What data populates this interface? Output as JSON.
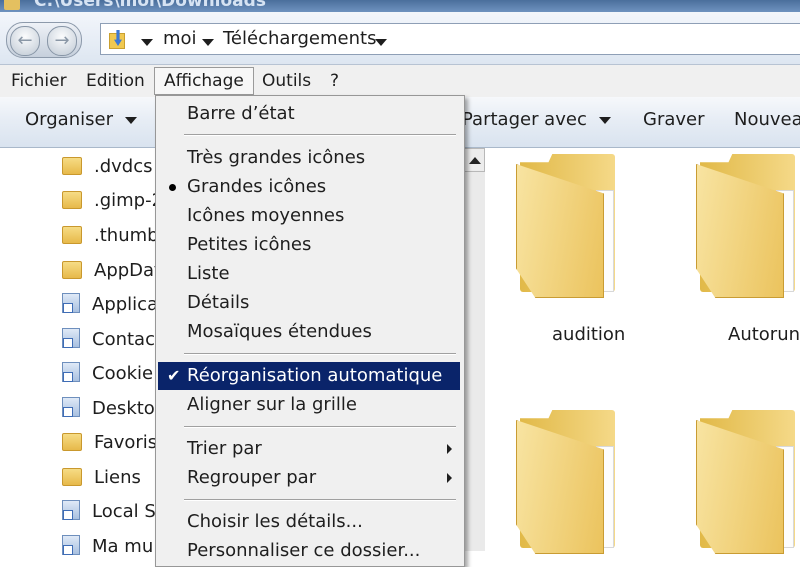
{
  "window": {
    "title": "C:\\Users\\moi\\Downloads"
  },
  "address_bar": {
    "crumbs": [
      "moi",
      "Téléchargements"
    ]
  },
  "menu_bar": {
    "items": [
      "Fichier",
      "Edition",
      "Affichage",
      "Outils",
      "?"
    ],
    "active": "Affichage"
  },
  "toolbar": {
    "organize": "Organiser",
    "share_with": "Partager avec",
    "burn": "Graver",
    "new_folder": "Nouvea"
  },
  "nav_pane": {
    "items": [
      {
        "label": ".dvdcs",
        "icon": "folder-icon"
      },
      {
        "label": ".gimp-2",
        "icon": "folder-icon"
      },
      {
        "label": ".thumb",
        "icon": "folder-icon"
      },
      {
        "label": "AppDat",
        "icon": "folder-icon"
      },
      {
        "label": "Applica",
        "icon": "shortcut-icon"
      },
      {
        "label": "Contac",
        "icon": "contacts-icon"
      },
      {
        "label": "Cookie",
        "icon": "shortcut-icon"
      },
      {
        "label": "Deskto",
        "icon": "desktop-icon"
      },
      {
        "label": "Favoris",
        "icon": "favorites-icon"
      },
      {
        "label": "Liens",
        "icon": "links-icon"
      },
      {
        "label": "Local S",
        "icon": "shortcut-icon"
      },
      {
        "label": "Ma mu",
        "icon": "shortcut-icon"
      }
    ]
  },
  "content": {
    "folders": [
      {
        "label": "audition"
      },
      {
        "label": "Autoruns"
      },
      {
        "label": ""
      },
      {
        "label": ""
      }
    ]
  },
  "view_menu": {
    "status_bar": "Barre d’état",
    "view_items": [
      "Très grandes icônes",
      "Grandes icônes",
      "Icônes moyennes",
      "Petites icônes",
      "Liste",
      "Détails",
      "Mosaïques étendues"
    ],
    "selected_view": "Grandes icônes",
    "auto_arrange": "Réorganisation automatique",
    "auto_arrange_checked": true,
    "align_to_grid": "Aligner sur la grille",
    "sort_by": "Trier par",
    "group_by": "Regrouper par",
    "choose_details": "Choisir les détails...",
    "customize_folder": "Personnaliser ce dossier..."
  },
  "colors": {
    "highlight": "#0a246a",
    "menu_bg": "#f0f0f0"
  }
}
